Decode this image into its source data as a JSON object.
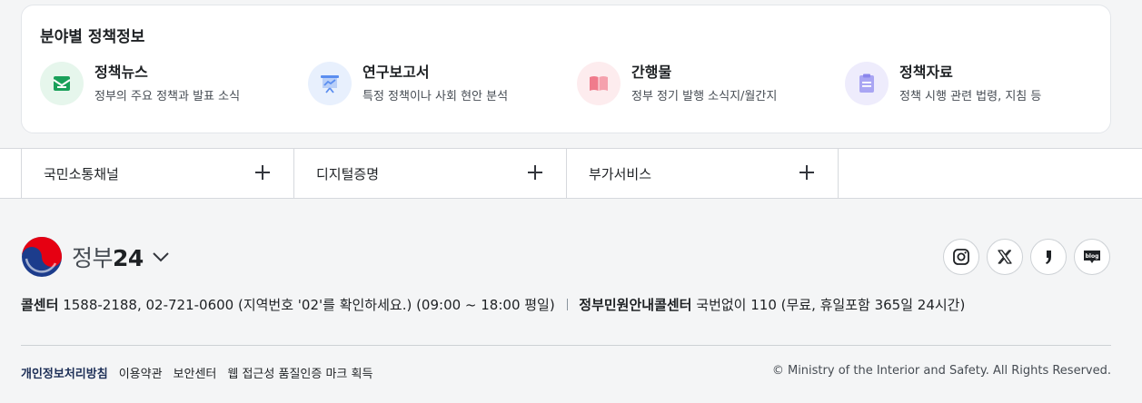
{
  "policy": {
    "title": "분야별 정책정보",
    "items": [
      {
        "name": "정책뉴스",
        "desc": "정부의 주요 정책과 발표 소식",
        "icon": "news-envelope-icon",
        "bg": "#e6f6ec",
        "color": "#1aa05a"
      },
      {
        "name": "연구보고서",
        "desc": "특정 정책이나 사회 현안 분석",
        "icon": "presentation-board-icon",
        "bg": "#e8f0fd",
        "color": "#5b8ef0"
      },
      {
        "name": "간행물",
        "desc": "정부 정기 발행 소식지/월간지",
        "icon": "open-book-icon",
        "bg": "#fdecee",
        "color": "#f07b8c"
      },
      {
        "name": "정책자료",
        "desc": "정책 시행 관련 법령, 지침 등",
        "icon": "document-icon",
        "bg": "#eeecfc",
        "color": "#8b86ec"
      }
    ]
  },
  "accordion": {
    "items": [
      {
        "label": "국민소통채널"
      },
      {
        "label": "디지털증명"
      },
      {
        "label": "부가서비스"
      }
    ]
  },
  "footer": {
    "logo_text": "정부",
    "logo_num": "24",
    "social": [
      "instagram-icon",
      "x-icon",
      "quote-icon",
      "blog-icon"
    ],
    "contact": {
      "label1": "콜센터",
      "text1": "1588-2188, 02-721-0600 (지역번호 '02'를 확인하세요.) (09:00 ~ 18:00 평일)",
      "label2": "정부민원안내콜센터",
      "text2": "국번없이 110 (무료, 휴일포함 365일 24시간)"
    },
    "links": [
      "개인정보처리방침",
      "이용약관",
      "보안센터",
      "웹 접근성 품질인증 마크 획득"
    ],
    "copyright": "© Ministry of the Interior and Safety. All Rights Reserved."
  }
}
